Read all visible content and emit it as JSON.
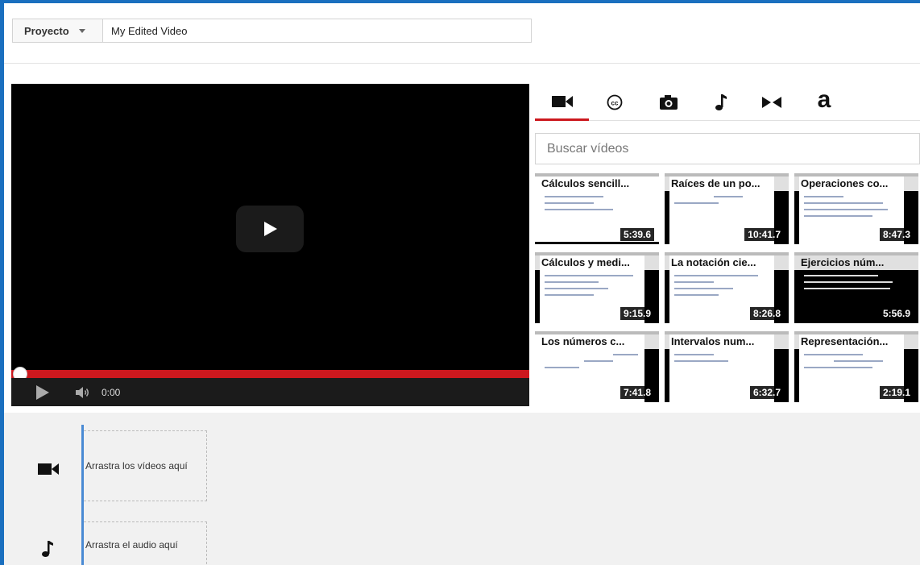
{
  "header": {
    "project_label": "Proyecto",
    "title_value": "My Edited Video"
  },
  "player": {
    "time": "0:00"
  },
  "tabs": [
    {
      "name": "video-camera-icon",
      "label": ""
    },
    {
      "name": "cc-icon",
      "label": ""
    },
    {
      "name": "camera-icon",
      "label": ""
    },
    {
      "name": "music-note-icon",
      "label": ""
    },
    {
      "name": "transition-icon",
      "label": ""
    },
    {
      "name": "text-icon",
      "label": "a"
    }
  ],
  "search": {
    "placeholder": "Buscar vídeos"
  },
  "videos": [
    {
      "title": "Cálculos sencill...",
      "duration": "5:39.6"
    },
    {
      "title": "Raíces de un po...",
      "duration": "10:41.7"
    },
    {
      "title": "Operaciones co...",
      "duration": "8:47.3"
    },
    {
      "title": "Cálculos y medi...",
      "duration": "9:15.9"
    },
    {
      "title": "La notación cie...",
      "duration": "8:26.8"
    },
    {
      "title": "Ejercicios núm...",
      "duration": "5:56.9"
    },
    {
      "title": "Los números c...",
      "duration": "7:41.8"
    },
    {
      "title": "Intervalos num...",
      "duration": "6:32.7"
    },
    {
      "title": "Representación...",
      "duration": "2:19.1"
    }
  ],
  "timeline": {
    "video_drop": "Arrastra los vídeos aquí",
    "audio_drop": "Arrastra el audio aquí"
  },
  "colors": {
    "accent": "#cc181e",
    "frame": "#1a6fbf",
    "timeline_marker": "#4a8ad4"
  }
}
